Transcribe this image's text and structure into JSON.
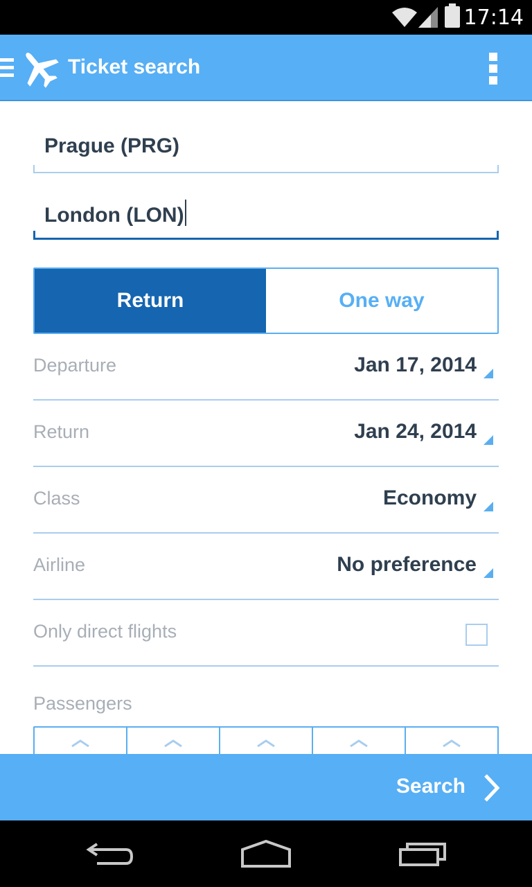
{
  "status_bar": {
    "time": "17:14",
    "icons": [
      "wifi-icon",
      "signal-icon",
      "battery-icon"
    ]
  },
  "action_bar": {
    "title": "Ticket search",
    "icons": [
      "drawer-menu-icon",
      "airplane-icon",
      "overflow-menu-icon"
    ]
  },
  "form": {
    "origin": "Prague (PRG)",
    "destination": "London (LON)",
    "trip_type": {
      "options": [
        "Return",
        "One way"
      ],
      "selected": "Return"
    },
    "rows": {
      "departure": {
        "label": "Departure",
        "value": "Jan 17, 2014"
      },
      "return": {
        "label": "Return",
        "value": "Jan 24, 2014"
      },
      "class": {
        "label": "Class",
        "value": "Economy"
      },
      "airline": {
        "label": "Airline",
        "value": "No preference"
      },
      "direct": {
        "label": "Only direct flights",
        "checked": false
      }
    },
    "passengers_label": "Passengers"
  },
  "search_bar": {
    "label": "Search",
    "icon": "chevron-right-icon"
  },
  "nav_bar": {
    "icons": [
      "back-icon",
      "home-icon",
      "recents-icon"
    ]
  },
  "colors": {
    "primary": "#57aff5",
    "primary_dark": "#1565b0",
    "text_dark": "#2f3f4f",
    "text_muted": "#a8aeb6",
    "divider": "#a9cdee"
  }
}
